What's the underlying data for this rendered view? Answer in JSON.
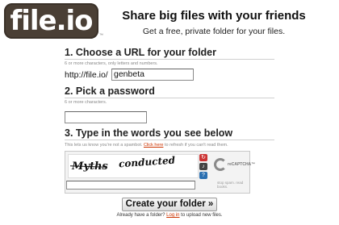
{
  "header": {
    "logo_text": "file.io",
    "logo_mark": "™",
    "headline": "Share big files with your friends",
    "tagline": "Get a free, private folder for your files."
  },
  "step1": {
    "title": "1. Choose a URL for your folder",
    "hint": "6 or more characters, only letters and numbers.",
    "url_prefix": "http://file.io/",
    "folder_value": "genbeta"
  },
  "step2": {
    "title": "2. Pick a password",
    "hint": "6 or more characters.",
    "password_value": ""
  },
  "step3": {
    "title": "3. Type in the words you see below",
    "hint_before": "This lets us know you're not a spambot. ",
    "hint_link": "Click here",
    "hint_after": " to refresh if you can't read them.",
    "captcha_word1": "Myths",
    "captcha_word2": "conducted",
    "captcha_answer": "",
    "recaptcha_label": "reCAPTCHA™",
    "recaptcha_tagline": "stop spam. read books."
  },
  "submit": {
    "label": "Create your folder »"
  },
  "footer": {
    "text_before": "Already have a folder? ",
    "link": "Log in",
    "text_after": " to upload new files."
  },
  "colors": {
    "logo_bg": "#4a3f35",
    "link": "#cc3300"
  }
}
